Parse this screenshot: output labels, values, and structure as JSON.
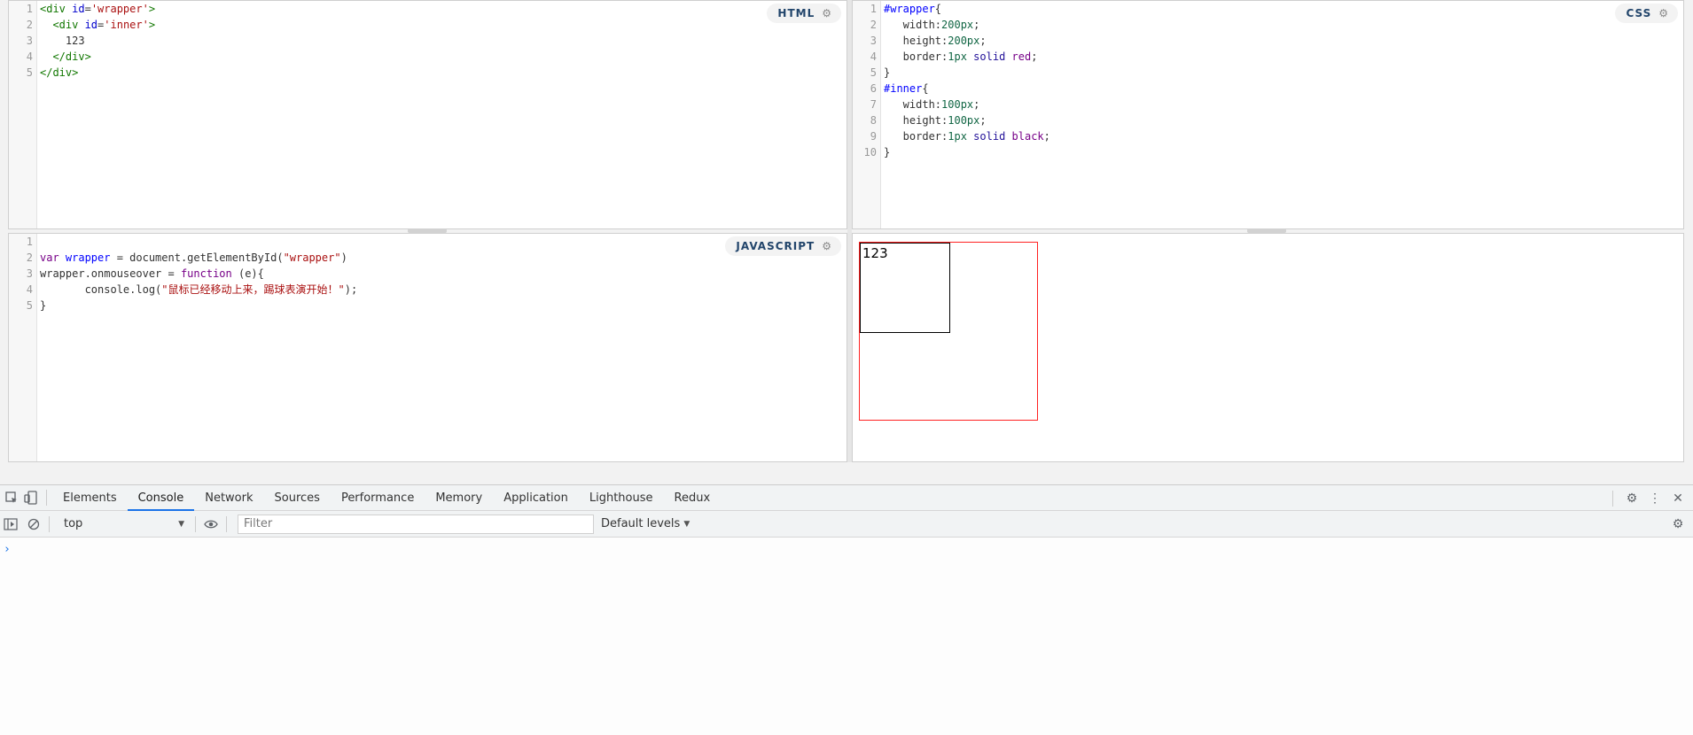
{
  "panes": {
    "html": {
      "label": "HTML",
      "lines": [
        {
          "n": "1",
          "parts": [
            [
              "tag",
              "<div "
            ],
            [
              "attr",
              "id"
            ],
            [
              "prop",
              "="
            ],
            [
              "str",
              "'wrapper'"
            ],
            [
              "tag",
              ">"
            ]
          ]
        },
        {
          "n": "2",
          "parts": [
            [
              "prop",
              "  "
            ],
            [
              "tag",
              "<div "
            ],
            [
              "attr",
              "id"
            ],
            [
              "prop",
              "="
            ],
            [
              "str",
              "'inner'"
            ],
            [
              "tag",
              ">"
            ]
          ]
        },
        {
          "n": "3",
          "parts": [
            [
              "prop",
              "    123"
            ]
          ]
        },
        {
          "n": "4",
          "parts": [
            [
              "prop",
              "  "
            ],
            [
              "tag",
              "</div>"
            ]
          ]
        },
        {
          "n": "5",
          "parts": [
            [
              "tag",
              "</div>"
            ]
          ]
        }
      ]
    },
    "css": {
      "label": "CSS",
      "lines": [
        {
          "n": "1",
          "parts": [
            [
              "def",
              "#wrapper"
            ],
            [
              "prop",
              "{"
            ]
          ]
        },
        {
          "n": "2",
          "parts": [
            [
              "prop",
              "   width:"
            ],
            [
              "num",
              "200px"
            ],
            [
              "prop",
              ";"
            ]
          ]
        },
        {
          "n": "3",
          "parts": [
            [
              "prop",
              "   height:"
            ],
            [
              "num",
              "200px"
            ],
            [
              "prop",
              ";"
            ]
          ]
        },
        {
          "n": "4",
          "parts": [
            [
              "prop",
              "   border:"
            ],
            [
              "num",
              "1px"
            ],
            [
              "prop",
              " "
            ],
            [
              "atom",
              "solid"
            ],
            [
              "prop",
              " "
            ],
            [
              "kw",
              "red"
            ],
            [
              "prop",
              ";"
            ]
          ]
        },
        {
          "n": "5",
          "parts": [
            [
              "prop",
              "}"
            ]
          ]
        },
        {
          "n": "6",
          "parts": [
            [
              "def",
              "#inner"
            ],
            [
              "prop",
              "{"
            ]
          ]
        },
        {
          "n": "7",
          "parts": [
            [
              "prop",
              "   width:"
            ],
            [
              "num",
              "100px"
            ],
            [
              "prop",
              ";"
            ]
          ]
        },
        {
          "n": "8",
          "parts": [
            [
              "prop",
              "   height:"
            ],
            [
              "num",
              "100px"
            ],
            [
              "prop",
              ";"
            ]
          ]
        },
        {
          "n": "9",
          "parts": [
            [
              "prop",
              "   border:"
            ],
            [
              "num",
              "1px"
            ],
            [
              "prop",
              " "
            ],
            [
              "atom",
              "solid"
            ],
            [
              "prop",
              " "
            ],
            [
              "kw",
              "black"
            ],
            [
              "prop",
              ";"
            ]
          ]
        },
        {
          "n": "10",
          "parts": [
            [
              "prop",
              "}"
            ]
          ]
        }
      ]
    },
    "js": {
      "label": "JAVASCRIPT",
      "lines": [
        {
          "n": "1",
          "parts": [
            [
              "prop",
              ""
            ]
          ]
        },
        {
          "n": "2",
          "parts": [
            [
              "kwjs",
              "var "
            ],
            [
              "def",
              "wrapper"
            ],
            [
              "prop",
              " = document.getElementById("
            ],
            [
              "str",
              "\"wrapper\""
            ],
            [
              "prop",
              ")"
            ]
          ]
        },
        {
          "n": "3",
          "parts": [
            [
              "prop",
              "wrapper.onmouseover = "
            ],
            [
              "kwjs",
              "function"
            ],
            [
              "prop",
              " (e){"
            ]
          ]
        },
        {
          "n": "4",
          "parts": [
            [
              "prop",
              "       console.log("
            ],
            [
              "str",
              "\"鼠标已经移动上来，踢球表演开始！\""
            ],
            [
              "prop",
              ");"
            ]
          ]
        },
        {
          "n": "5",
          "parts": [
            [
              "prop",
              "}"
            ]
          ]
        }
      ]
    },
    "output": {
      "text": "123"
    }
  },
  "devtools": {
    "tabs": [
      "Elements",
      "Console",
      "Network",
      "Sources",
      "Performance",
      "Memory",
      "Application",
      "Lighthouse",
      "Redux"
    ],
    "active_tab": "Console",
    "context": "top",
    "filter_placeholder": "Filter",
    "levels_label": "Default levels",
    "prompt_symbol": "›"
  }
}
